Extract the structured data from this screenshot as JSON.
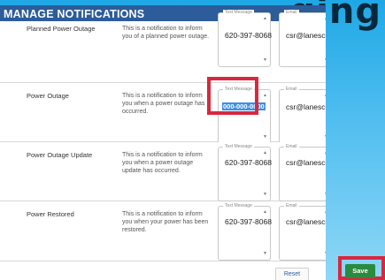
{
  "background_fragment": "ging",
  "panel": {
    "title": "MANAGE NOTIFICATIONS"
  },
  "rows": [
    {
      "type": "Planned Power Outage",
      "description": "This is a notification to inform you of a planned power outage.",
      "text_label": "Text Message",
      "text_value": "620-397-8068",
      "email_label": "Email",
      "email_value": "csr@lanescott.coop"
    },
    {
      "type": "Power Outage",
      "description": "This is a notification to inform you when a power outage has occurred.",
      "text_label": "Text Message",
      "text_value": "000-000-0000",
      "email_label": "Email",
      "email_value": "csr@lanescott.coop"
    },
    {
      "type": "Power Outage Update",
      "description": "This is a notification to inform you when a power outage update has occurred.",
      "text_label": "Text Message",
      "text_value": "620-397-8068",
      "email_label": "Email",
      "email_value": "csr@lanescott.coop"
    },
    {
      "type": "Power Restored",
      "description": "This is a notification to inform you when your power has been restored.",
      "text_label": "Text Message",
      "text_value": "620-397-8068",
      "email_label": "Email",
      "email_value": "csr@lanescott.coop"
    }
  ],
  "buttons": {
    "reset": "Reset",
    "save": "Save"
  },
  "colors": {
    "header": "#2c5c9a",
    "highlight": "#d8283e",
    "save": "#2a8a3e",
    "selection": "#3d8ee6"
  }
}
